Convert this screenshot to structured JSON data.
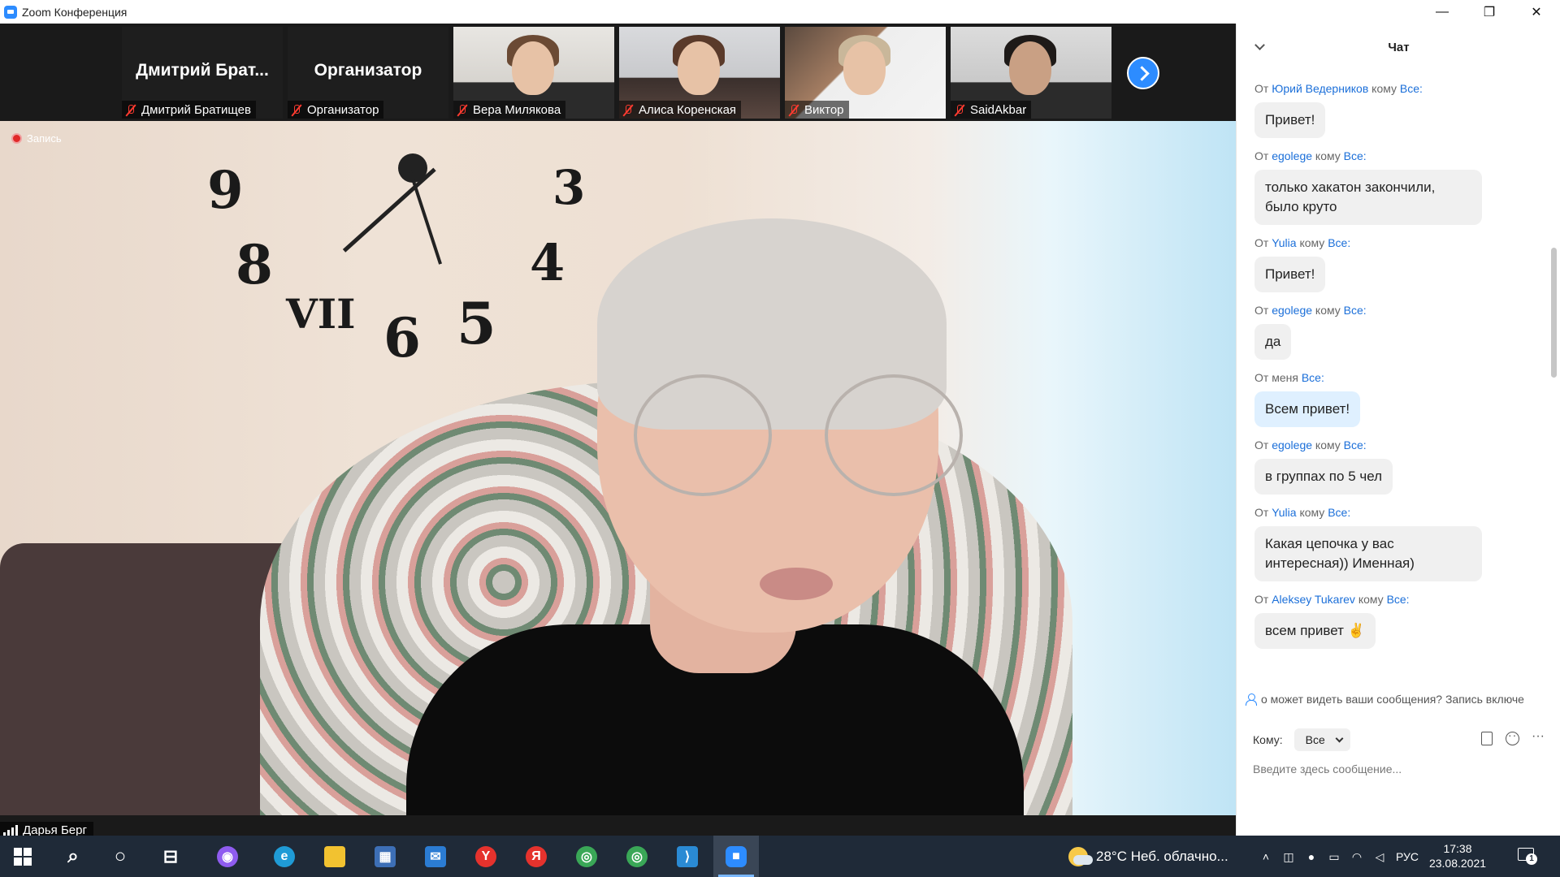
{
  "window": {
    "title": "Zoom Конференция",
    "controls": [
      "—",
      "❐",
      "✕"
    ]
  },
  "gallery": {
    "tiles": [
      {
        "big_name": "Дмитрий Брат...",
        "name": "Дмитрий Братищев",
        "video": false
      },
      {
        "big_name": "Организатор",
        "name": "Организатор",
        "video": false
      },
      {
        "name": "Вера Милякова",
        "video": true
      },
      {
        "name": "Алиса Коренская",
        "video": true
      },
      {
        "name": "Виктор",
        "video": true
      },
      {
        "name": "SaidAkbar",
        "video": true
      }
    ],
    "next_icon": "chevron-right-icon"
  },
  "main": {
    "recording_label": "Запись",
    "speaker_name": "Дарья Берг",
    "clock_marks": [
      "9",
      "3",
      "8",
      "4",
      "VII",
      "6",
      "5"
    ]
  },
  "chat": {
    "title": "Чат",
    "messages": [
      {
        "from_prefix": "От",
        "sender": "Юрий Ведерников",
        "to_prefix": "кому",
        "recipient": "Все:",
        "text": "Привет!",
        "mine": false
      },
      {
        "from_prefix": "От",
        "sender": "egolege",
        "to_prefix": "кому",
        "recipient": "Все:",
        "text": "только хакатон закончили, было круто",
        "mine": false
      },
      {
        "from_prefix": "От",
        "sender": "Yulia",
        "to_prefix": "кому",
        "recipient": "Все:",
        "text": "Привет!",
        "mine": false
      },
      {
        "from_prefix": "От",
        "sender": "egolege",
        "to_prefix": "кому",
        "recipient": "Все:",
        "text": "да",
        "mine": false
      },
      {
        "from_prefix": "От",
        "sender": "меня",
        "to_prefix": "",
        "recipient": "Все:",
        "text": "Всем привет!",
        "mine": true
      },
      {
        "from_prefix": "От",
        "sender": "egolege",
        "to_prefix": "кому",
        "recipient": "Все:",
        "text": "в группах по 5 чел",
        "mine": false
      },
      {
        "from_prefix": "От",
        "sender": "Yulia",
        "to_prefix": "кому",
        "recipient": "Все:",
        "text": "Какая цепочка у вас интересная)) Именная)",
        "mine": false
      },
      {
        "from_prefix": "От",
        "sender": "Aleksey Tukarev",
        "to_prefix": "кому",
        "recipient": "Все:",
        "text": "всем привет ✌",
        "mine": false
      }
    ],
    "privacy_notice": "о может видеть ваши сообщения? Запись включе",
    "to_label": "Кому:",
    "to_value": "Все",
    "input_placeholder": "Введите здесь сообщение..."
  },
  "taskbar": {
    "weather": "28°C  Неб. облачно...",
    "lang": "РУС",
    "time": "17:38",
    "date": "23.08.2021",
    "notifications": "1",
    "apps": [
      {
        "name": "start-button",
        "glyph": "",
        "color": ""
      },
      {
        "name": "search-icon",
        "glyph": "⌕",
        "color": ""
      },
      {
        "name": "cortana-icon",
        "glyph": "○",
        "color": ""
      },
      {
        "name": "task-view-icon",
        "glyph": "⊟",
        "color": ""
      },
      {
        "name": "alice-icon",
        "glyph": "◉",
        "color": "#8f5cf0"
      },
      {
        "name": "edge-icon",
        "glyph": "e",
        "color": "#1f9bd6"
      },
      {
        "name": "explorer-icon",
        "glyph": "▬",
        "color": "#f2c230"
      },
      {
        "name": "store-icon",
        "glyph": "▦",
        "color": "#3d6fb6"
      },
      {
        "name": "mail-icon",
        "glyph": "✉",
        "color": "#2b7cd3"
      },
      {
        "name": "yandex-browser-icon",
        "glyph": "Y",
        "color": "#e5322d"
      },
      {
        "name": "yandex-icon",
        "glyph": "Я",
        "color": "#e5322d"
      },
      {
        "name": "chrome-icon",
        "glyph": "◎",
        "color": "#3aa757"
      },
      {
        "name": "chrome-profile-icon",
        "glyph": "◎",
        "color": "#3aa757"
      },
      {
        "name": "vscode-icon",
        "glyph": "⟩",
        "color": "#2a8ad4"
      },
      {
        "name": "zoom-icon",
        "glyph": "■",
        "color": "#2d8cff"
      }
    ]
  }
}
